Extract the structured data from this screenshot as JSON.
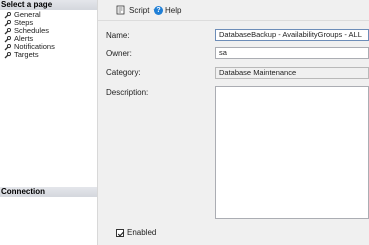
{
  "left": {
    "select_page_header": "Select a page",
    "pages": [
      {
        "label": "General"
      },
      {
        "label": "Steps"
      },
      {
        "label": "Schedules"
      },
      {
        "label": "Alerts"
      },
      {
        "label": "Notifications"
      },
      {
        "label": "Targets"
      }
    ],
    "connection_header": "Connection"
  },
  "toolbar": {
    "script_label": "Script",
    "help_label": "Help"
  },
  "form": {
    "name_label": "Name:",
    "name_value": "DatabaseBackup - AvailabilityGroups - ALL",
    "owner_label": "Owner:",
    "owner_value": "sa",
    "category_label": "Category:",
    "category_value": "Database Maintenance",
    "description_label": "Description:",
    "description_value": "",
    "enabled_label": "Enabled",
    "enabled_checked": true
  },
  "colors": {
    "accent": "#1f7fd6",
    "header_bg": "#d4d7dd",
    "pane_bg": "#f0f0f0"
  }
}
